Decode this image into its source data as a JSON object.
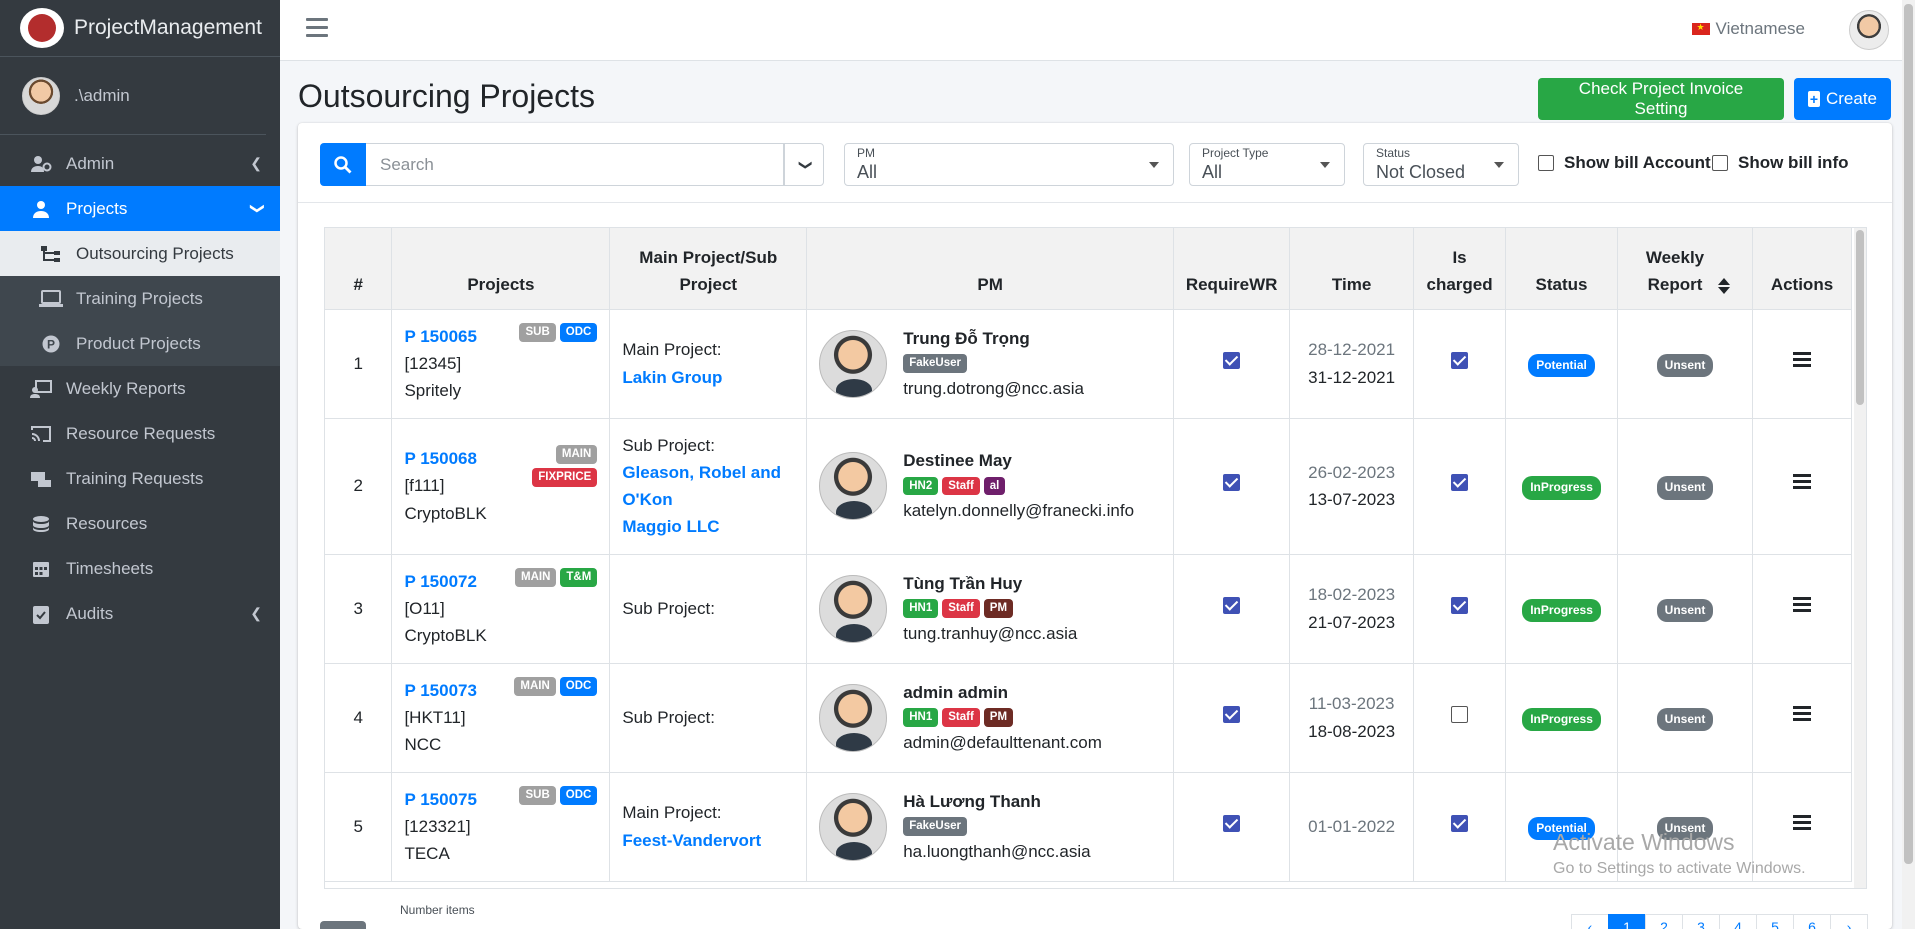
{
  "brand": {
    "name": "ProjectManagement"
  },
  "user": {
    "name": ".\\admin"
  },
  "sidebar": {
    "items": [
      {
        "label": "Admin",
        "icon": "users-cog-icon"
      },
      {
        "label": "Projects",
        "icon": "user-icon"
      },
      {
        "label": "Outsourcing Projects",
        "icon": "sitemap-icon"
      },
      {
        "label": "Training Projects",
        "icon": "laptop-icon"
      },
      {
        "label": "Product Projects",
        "icon": "product-p-icon"
      },
      {
        "label": "Weekly Reports",
        "icon": "report-user-icon"
      },
      {
        "label": "Resource Requests",
        "icon": "cast-icon"
      },
      {
        "label": "Training Requests",
        "icon": "training-icon"
      },
      {
        "label": "Resources",
        "icon": "database-icon"
      },
      {
        "label": "Timesheets",
        "icon": "calendar-icon"
      },
      {
        "label": "Audits",
        "icon": "clipboard-check-icon"
      }
    ]
  },
  "topbar": {
    "language": "Vietnamese"
  },
  "page": {
    "title": "Outsourcing Projects",
    "check_invoice_label": "Check Project Invoice Setting",
    "create_label": "Create"
  },
  "filters": {
    "search_placeholder": "Search",
    "pm": {
      "label": "PM",
      "value": "All"
    },
    "project_type": {
      "label": "Project Type",
      "value": "All"
    },
    "status": {
      "label": "Status",
      "value": "Not Closed"
    },
    "show_bill_account": "Show bill Account",
    "show_bill_info": "Show bill info"
  },
  "table": {
    "headers": {
      "num": "#",
      "projects": "Projects",
      "main_sub": "Main Project/Sub Project",
      "pm": "PM",
      "requirewr": "RequireWR",
      "time": "Time",
      "is_charged": "Is charged",
      "status": "Status",
      "weekly_report": "Weekly Report",
      "actions": "Actions"
    },
    "rows": [
      {
        "num": "1",
        "code": "P 150065",
        "sub_code": "[12345]",
        "client": "Spritely",
        "tags": [
          "SUB",
          "ODC"
        ],
        "mp_label": "Main Project:",
        "mp_links": [
          "Lakin Group"
        ],
        "pm_name": "Trung Đỗ Trọng",
        "pm_badges": [
          "FakeUser"
        ],
        "pm_email": "trung.dotrong@ncc.asia",
        "requirewr": true,
        "date_start": "28-12-2021",
        "date_end": "31-12-2021",
        "is_charged": true,
        "status": "Potential",
        "weekly": "Unsent"
      },
      {
        "num": "2",
        "code": "P 150068",
        "sub_code": "[f111]",
        "client": "CryptoBLK",
        "tags": [
          "MAIN",
          "FIXPRICE"
        ],
        "mp_label": "Sub Project:",
        "mp_links": [
          "Gleason, Robel and O'Kon",
          "Maggio LLC"
        ],
        "pm_name": "Destinee May",
        "pm_badges": [
          "HN2",
          "Staff",
          "al"
        ],
        "pm_email": "katelyn.donnelly@franecki.info",
        "requirewr": true,
        "date_start": "26-02-2023",
        "date_end": "13-07-2023",
        "is_charged": true,
        "status": "InProgress",
        "weekly": "Unsent"
      },
      {
        "num": "3",
        "code": "P 150072",
        "sub_code": "[O11]",
        "client": "CryptoBLK",
        "tags": [
          "MAIN",
          "T&M"
        ],
        "mp_label": "Sub Project:",
        "mp_links": [],
        "pm_name": "Tùng Trần Huy",
        "pm_badges": [
          "HN1",
          "Staff",
          "PM"
        ],
        "pm_email": "tung.tranhuy@ncc.asia",
        "requirewr": true,
        "date_start": "18-02-2023",
        "date_end": "21-07-2023",
        "is_charged": true,
        "status": "InProgress",
        "weekly": "Unsent"
      },
      {
        "num": "4",
        "code": "P 150073",
        "sub_code": "[HKT11]",
        "client": "NCC",
        "tags": [
          "MAIN",
          "ODC"
        ],
        "mp_label": "Sub Project:",
        "mp_links": [],
        "pm_name": "admin admin",
        "pm_badges": [
          "HN1",
          "Staff",
          "PM"
        ],
        "pm_email": "admin@defaulttenant.com",
        "requirewr": true,
        "date_start": "11-03-2023",
        "date_end": "18-08-2023",
        "is_charged": false,
        "status": "InProgress",
        "weekly": "Unsent"
      },
      {
        "num": "5",
        "code": "P 150075",
        "sub_code": "[123321]",
        "client": "TECA",
        "tags": [
          "SUB",
          "ODC"
        ],
        "mp_label": "Main Project:",
        "mp_links": [
          "Feest-Vandervort"
        ],
        "pm_name": "Hà Lương Thanh",
        "pm_badges": [
          "FakeUser"
        ],
        "pm_email": "ha.luongthanh@ncc.asia",
        "requirewr": true,
        "date_start": "01-01-2022",
        "date_end": "",
        "is_charged": true,
        "status": "Potential",
        "weekly": "Unsent"
      }
    ]
  },
  "footer": {
    "number_items_label": "Number items",
    "pages": [
      "‹",
      "1",
      "2",
      "3",
      "4",
      "5",
      "6",
      "›"
    ]
  },
  "watermark": {
    "line1": "Activate Windows",
    "line2": "Go to Settings to activate Windows."
  },
  "colors": {
    "primary": "#007bff",
    "success": "#28a745",
    "sidebar": "#343a40",
    "danger": "#dc3545"
  }
}
